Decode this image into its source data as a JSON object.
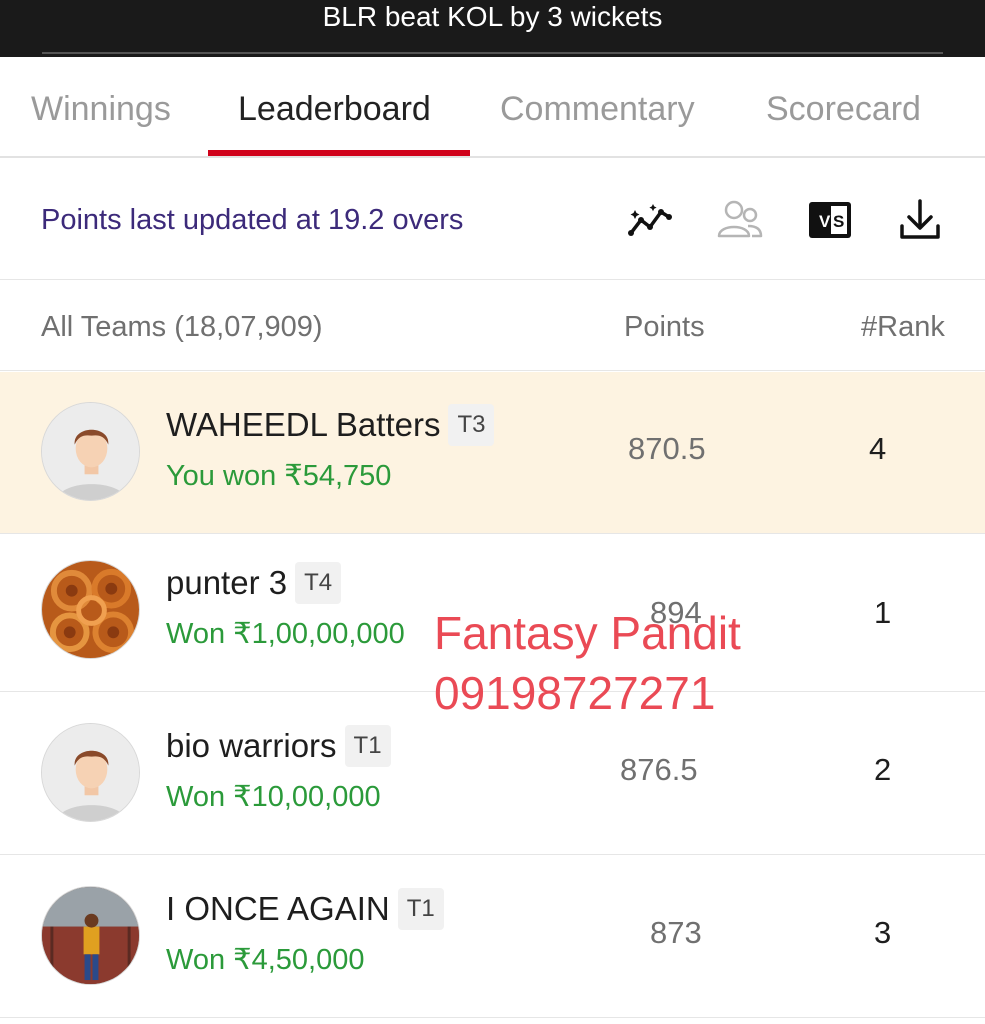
{
  "header": {
    "result": "BLR beat KOL by 3 wickets"
  },
  "tabs": [
    {
      "label": "Winnings",
      "active": false
    },
    {
      "label": "Leaderboard",
      "active": true
    },
    {
      "label": "Commentary",
      "active": false
    },
    {
      "label": "Scorecard",
      "active": false
    }
  ],
  "accent_color": "#d0021b",
  "update_info": {
    "text": "Points last updated at 19.2 overs",
    "icons": [
      "stats-graph-icon",
      "compare-users-icon",
      "versus-icon",
      "download-icon"
    ]
  },
  "table": {
    "col_teams": "All Teams (18,07,909)",
    "col_points": "Points",
    "col_rank": "#Rank"
  },
  "teams": [
    {
      "name": "WAHEEDL Batters",
      "tag": "T3",
      "winnings": "You won ₹54,750",
      "points": "870.5",
      "rank": "4",
      "highlighted": true,
      "avatar": "default-avatar-icon"
    },
    {
      "name": "punter 3",
      "tag": "T4",
      "winnings": "Won ₹1,00,00,000",
      "points": "894",
      "rank": "1",
      "highlighted": false,
      "avatar": "food-photo-avatar"
    },
    {
      "name": "bio warriors",
      "tag": "T1",
      "winnings": "Won ₹10,00,000",
      "points": "876.5",
      "rank": "2",
      "highlighted": false,
      "avatar": "default-avatar-icon"
    },
    {
      "name": "I ONCE AGAIN",
      "tag": "T1",
      "winnings": "Won ₹4,50,000",
      "points": "873",
      "rank": "3",
      "highlighted": false,
      "avatar": "person-photo-avatar"
    }
  ],
  "watermark": {
    "line1": "Fantasy Pandit",
    "line2": "09198727271",
    "color": "#ea4a55"
  }
}
